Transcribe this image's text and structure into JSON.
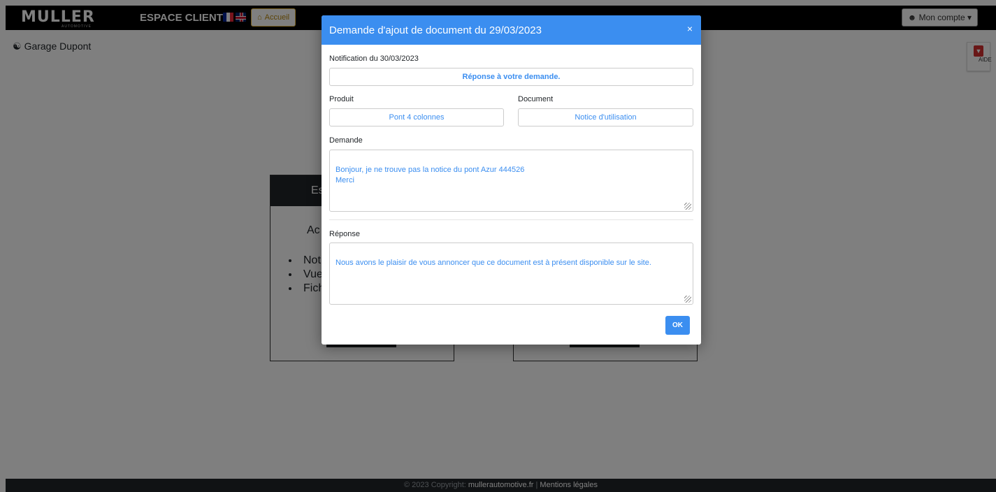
{
  "navbar": {
    "logo_text": "MULLER",
    "logo_sub": "AUTOMOTIVE",
    "title": "ESPACE CLIENT",
    "home_label": "Accueil",
    "account_label": "Mon compte",
    "home_icon": "home-icon",
    "account_icon": "user-icon"
  },
  "user": {
    "name": "Garage Dupont",
    "icon": "user-circle-icon"
  },
  "help": {
    "label": "AIDE",
    "icon": "pdf-icon"
  },
  "background_cards": [
    {
      "header": "Es",
      "sub": "Ac",
      "items": [
        "Notic",
        "Vues",
        "Fich"
      ]
    },
    {
      "header": "",
      "sub": "",
      "items": []
    }
  ],
  "modal": {
    "title": "Demande d'ajout de document du 29/03/2023",
    "close": "×",
    "notification": "Notification du 30/03/2023",
    "response_status": "Réponse à votre demande.",
    "produit_label": "Produit",
    "produit_value": "Pont 4 colonnes",
    "document_label": "Document",
    "document_value": "Notice d'utilisation",
    "demande_label": "Demande",
    "demande_text": "Bonjour, je ne trouve pas la notice du pont Azur 444526\nMerci",
    "reponse_label": "Réponse",
    "reponse_text": "Nous avons le plaisir de vous annoncer que ce document est à présent disponible sur le site.",
    "ok_label": "OK"
  },
  "footer": {
    "prefix": "© 2023 Copyright: ",
    "site": "mullerautomotive.fr",
    "sep": " | ",
    "legal": "Mentions légales"
  },
  "colors": {
    "accent": "#3b8ef0",
    "navbar": "#000000",
    "footer": "#212529"
  }
}
